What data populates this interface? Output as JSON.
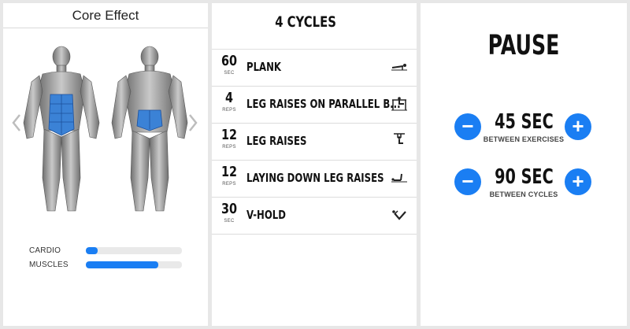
{
  "workout": {
    "title": "Core Effect",
    "meters": [
      {
        "label": "CARDIO",
        "level": 0.12
      },
      {
        "label": "MUSCLES",
        "level": 0.75
      }
    ]
  },
  "cycles": {
    "title": "4 CYCLES",
    "exercises": [
      {
        "count": "60",
        "unit": "SEC",
        "name": "PLANK",
        "icon": "plank-icon"
      },
      {
        "count": "4",
        "unit": "REPS",
        "name": "LEG RAISES ON PARALLEL B...",
        "icon": "parallel-bars-icon"
      },
      {
        "count": "12",
        "unit": "REPS",
        "name": "LEG RAISES",
        "icon": "hanging-leg-raise-icon"
      },
      {
        "count": "12",
        "unit": "REPS",
        "name": "LAYING DOWN LEG RAISES",
        "icon": "lying-leg-raise-icon"
      },
      {
        "count": "30",
        "unit": "SEC",
        "name": "V-HOLD",
        "icon": "v-hold-icon"
      }
    ]
  },
  "pause": {
    "title": "PAUSE",
    "timers": [
      {
        "value": "45 SEC",
        "caption": "BETWEEN EXERCISES"
      },
      {
        "value": "90 SEC",
        "caption": "BETWEEN CYCLES"
      }
    ],
    "minus_label": "−",
    "plus_label": "+"
  },
  "colors": {
    "accent": "#1a7ef3",
    "muscle_highlight": "#3b82d6"
  }
}
